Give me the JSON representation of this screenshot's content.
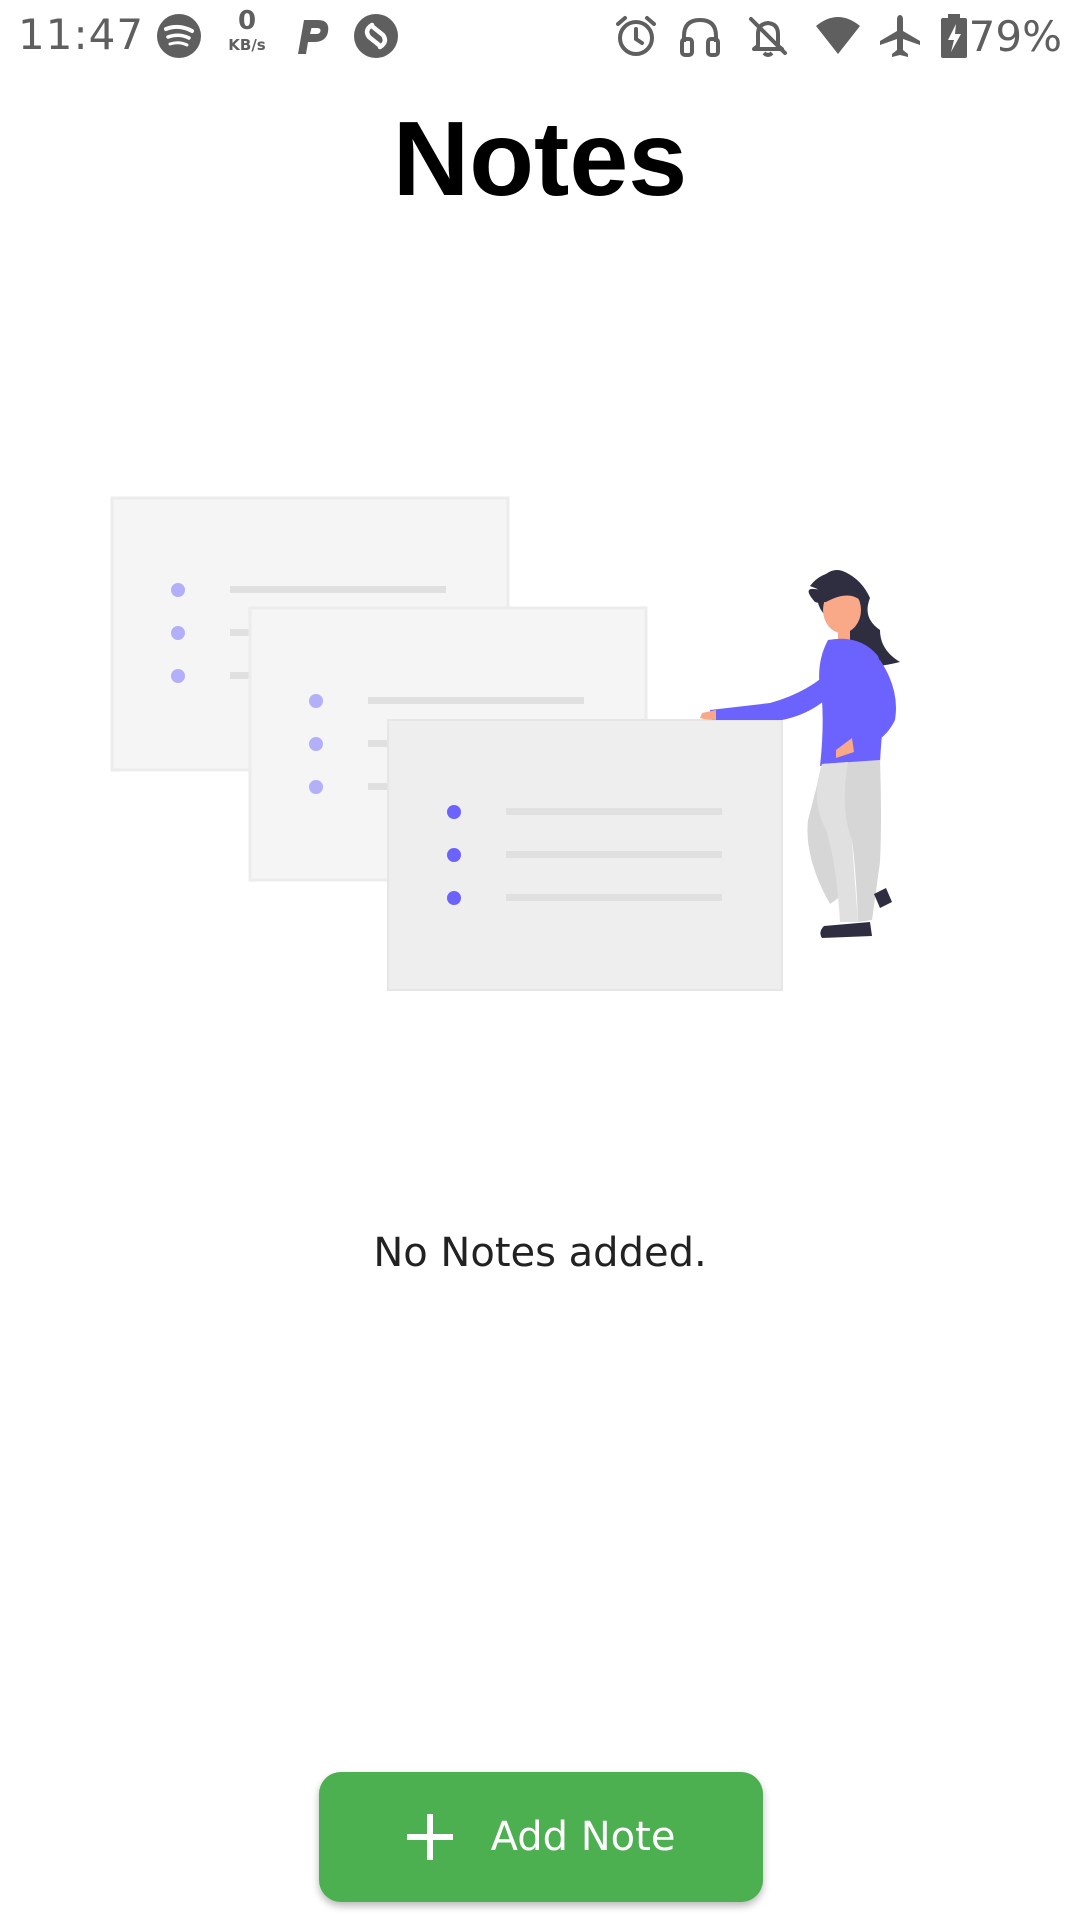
{
  "status_bar": {
    "time": "11:47",
    "net_speed_value": "0",
    "net_speed_unit": "KB/s",
    "battery_percent": "79%",
    "left_icons": [
      "spotify-icon",
      "net-speed-indicator",
      "parking-app-icon",
      "shazam-icon"
    ],
    "right_icons": [
      "alarm-icon",
      "headphones-icon",
      "notifications-off-icon",
      "wifi-icon",
      "airplane-mode-icon",
      "battery-charging-icon"
    ]
  },
  "header": {
    "title": "Notes"
  },
  "empty_state": {
    "message": "No Notes added.",
    "illustration": "woman-presenting-note-cards-illustration"
  },
  "add_button": {
    "label": "Add Note",
    "icon": "plus-icon",
    "color": "#4caf50"
  },
  "colors": {
    "accent_purple": "#6c63ff",
    "card_gray": "#eeeeee",
    "status_icon_gray": "#5f5f5f"
  }
}
